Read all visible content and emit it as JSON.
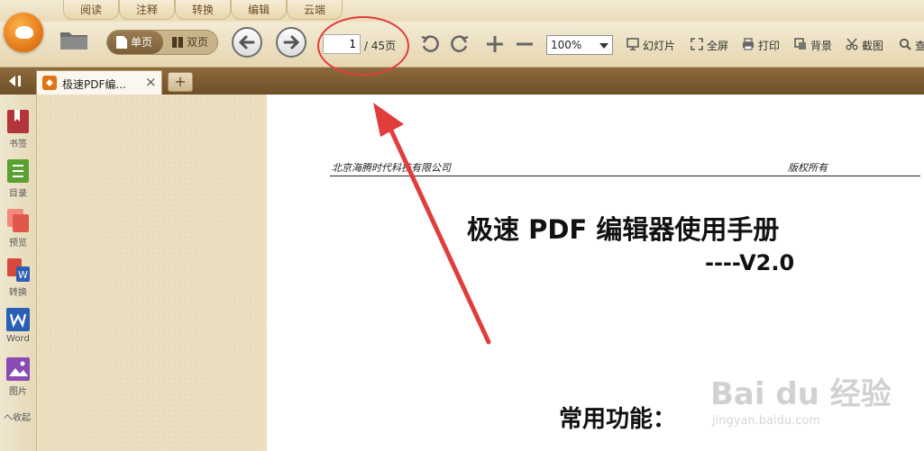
{
  "menu": {
    "tabs": [
      {
        "label": "阅读"
      },
      {
        "label": "注释"
      },
      {
        "label": "转换"
      },
      {
        "label": "编辑"
      },
      {
        "label": "云端"
      }
    ]
  },
  "toolbar": {
    "single_page_label": "单页",
    "double_page_label": "双页",
    "page_current": "1",
    "page_total": "/ 45页",
    "zoom_value": "100%",
    "slideshow_label": "幻灯片",
    "fullscreen_label": "全屏",
    "print_label": "打印",
    "background_label": "背景",
    "screenshot_label": "截图",
    "search_label": "查"
  },
  "tabs": {
    "doc_tab_label": "极速PDF编...",
    "close_symbol": "×",
    "new_tab_symbol": "+"
  },
  "sidebar": {
    "items": [
      {
        "label": "书签",
        "icon": "bookmark-icon",
        "color": "#b2353b"
      },
      {
        "label": "目录",
        "icon": "toc-icon",
        "color": "#5aa033"
      },
      {
        "label": "预览",
        "icon": "preview-icon",
        "color": "#e2574c"
      },
      {
        "label": "转换",
        "icon": "pdf-to-word-icon",
        "color": "#d64a3b"
      },
      {
        "label": "Word",
        "icon": "word-icon",
        "color": "#2b5fb4"
      },
      {
        "label": "图片",
        "icon": "image-icon",
        "color": "#8a4bb5"
      }
    ],
    "collapse_label": "へ收起"
  },
  "document": {
    "header_left": "北京海腾时代科技有限公司",
    "header_right": "版权所有",
    "title": "极速 PDF 编辑器使用手册",
    "version": "----V2.0",
    "section": "常用功能："
  },
  "watermark": {
    "logo_text": "Bai du 经验",
    "url": "jingyan.baidu.com"
  },
  "colors": {
    "accent": "#e07313",
    "annotation": "#e13d3d",
    "tabbar": "#7a5a30"
  }
}
